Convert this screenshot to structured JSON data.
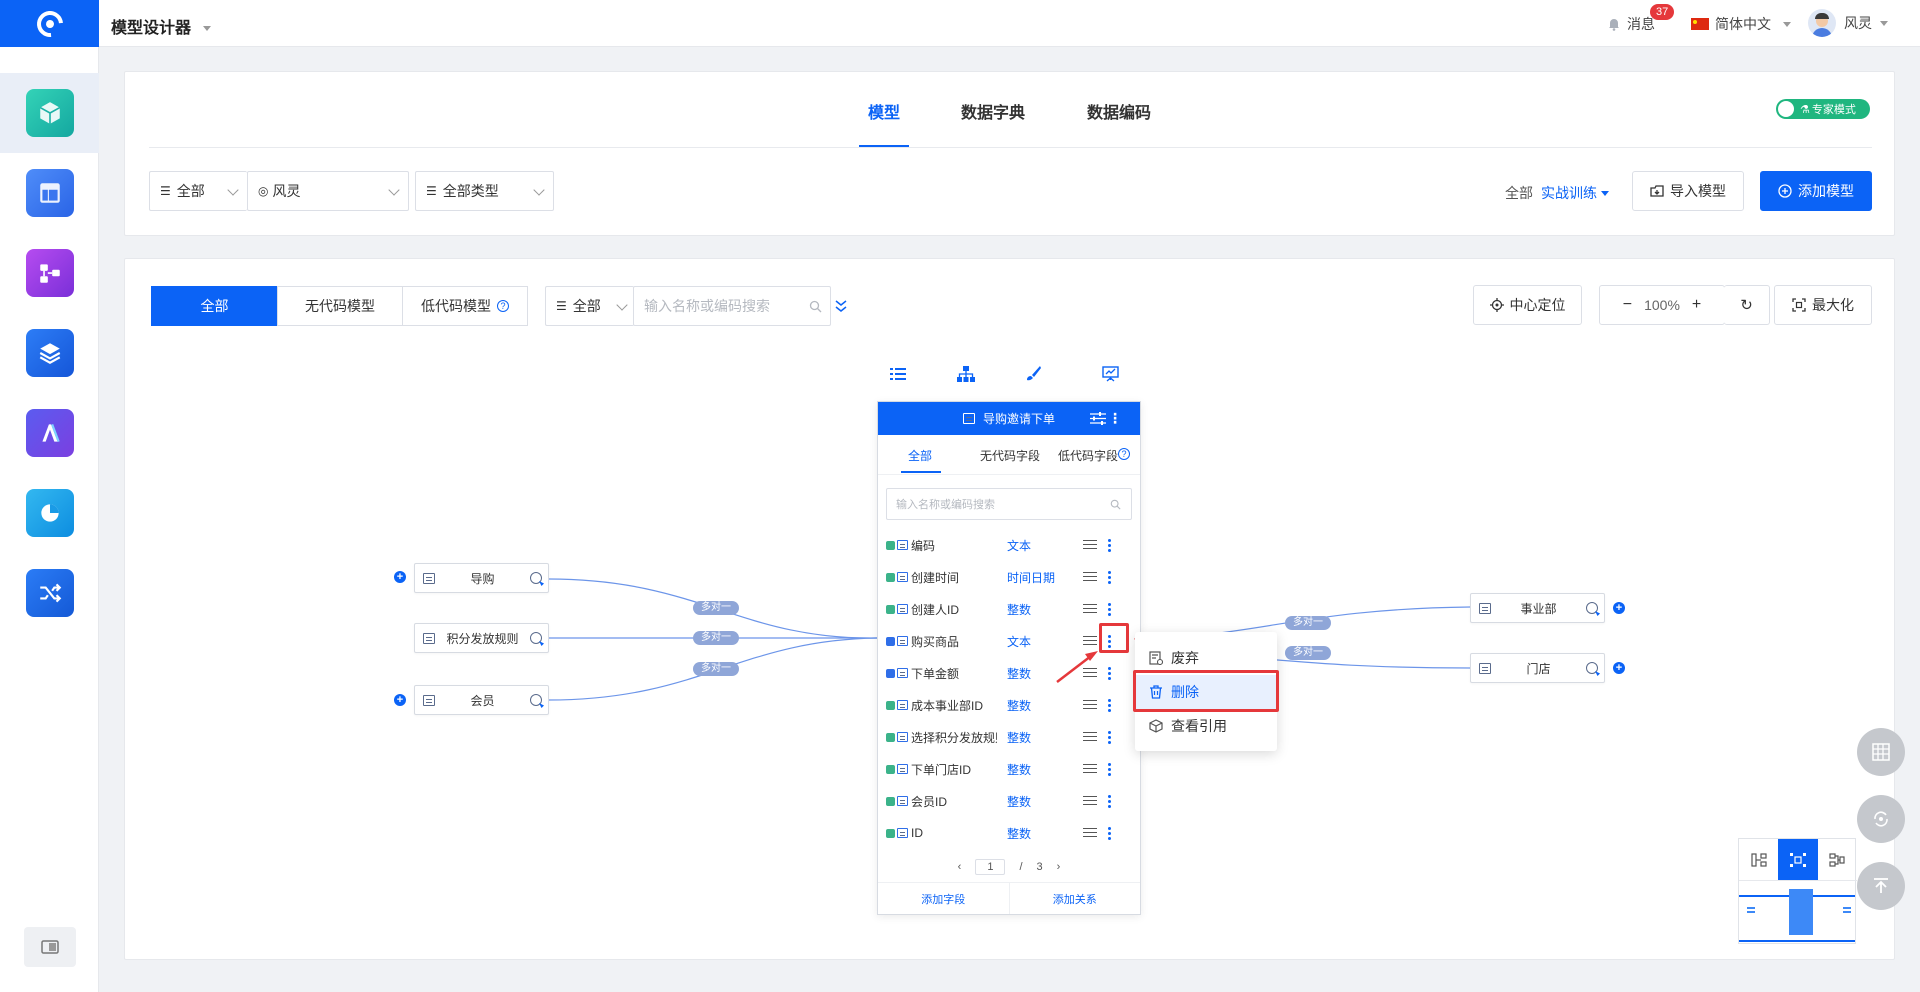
{
  "header": {
    "app_title": "模型设计器",
    "messages_label": "消息",
    "messages_badge": "37",
    "language": "简体中文",
    "user_name": "风灵"
  },
  "top_tabs": [
    "模型",
    "数据字典",
    "数据编码"
  ],
  "expert_mode": {
    "label": "专家模式",
    "on": true
  },
  "filters": {
    "scope": "全部",
    "owner": "风灵",
    "type": "全部类型",
    "env_prefix": "全部",
    "env": "实战训练",
    "import_label": "导入模型",
    "add_label": "添加模型"
  },
  "canvas_toolbar": {
    "seg_all": "全部",
    "seg_nocode": "无代码模型",
    "seg_lowcode": "低代码模型",
    "search_scope": "全部",
    "search_placeholder": "输入名称或编码搜索",
    "center_label": "中心定位",
    "zoom": "100%",
    "maximize_label": "最大化"
  },
  "left_nodes": [
    {
      "label": "导购",
      "relation": "多对一"
    },
    {
      "label": "积分发放规则",
      "relation": "多对一"
    },
    {
      "label": "会员",
      "relation": "多对一"
    }
  ],
  "right_nodes": [
    {
      "label": "事业部",
      "relation": "多对一"
    },
    {
      "label": "门店",
      "relation": "多对一"
    }
  ],
  "entity": {
    "title": "导购邀请下单",
    "tabs": [
      "全部",
      "无代码字段",
      "低代码字段"
    ],
    "search_placeholder": "输入名称或编码搜索",
    "fields": [
      {
        "name": "编码",
        "type": "文本",
        "kind": "nocode"
      },
      {
        "name": "创建时间",
        "type": "时间日期",
        "kind": "nocode"
      },
      {
        "name": "创建人ID",
        "type": "整数",
        "kind": "nocode"
      },
      {
        "name": "购买商品",
        "type": "文本",
        "kind": "lowcode"
      },
      {
        "name": "下单金额",
        "type": "整数",
        "kind": "lowcode"
      },
      {
        "name": "成本事业部ID",
        "type": "整数",
        "kind": "nocode"
      },
      {
        "name": "选择积分发放规则",
        "type": "整数",
        "kind": "nocode"
      },
      {
        "name": "下单门店ID",
        "type": "整数",
        "kind": "nocode"
      },
      {
        "name": "会员ID",
        "type": "整数",
        "kind": "nocode"
      },
      {
        "name": "ID",
        "type": "整数",
        "kind": "nocode"
      }
    ],
    "page_current": "1",
    "page_sep": "/",
    "page_total": "3",
    "add_field": "添加字段",
    "add_relation": "添加关系"
  },
  "context_menu": [
    "废弃",
    "删除",
    "查看引用"
  ],
  "colors": {
    "primary": "#0b63f6",
    "highlight": "#e5383b",
    "nocode": "#3bb38a",
    "lowcode": "#2f6ee8"
  }
}
